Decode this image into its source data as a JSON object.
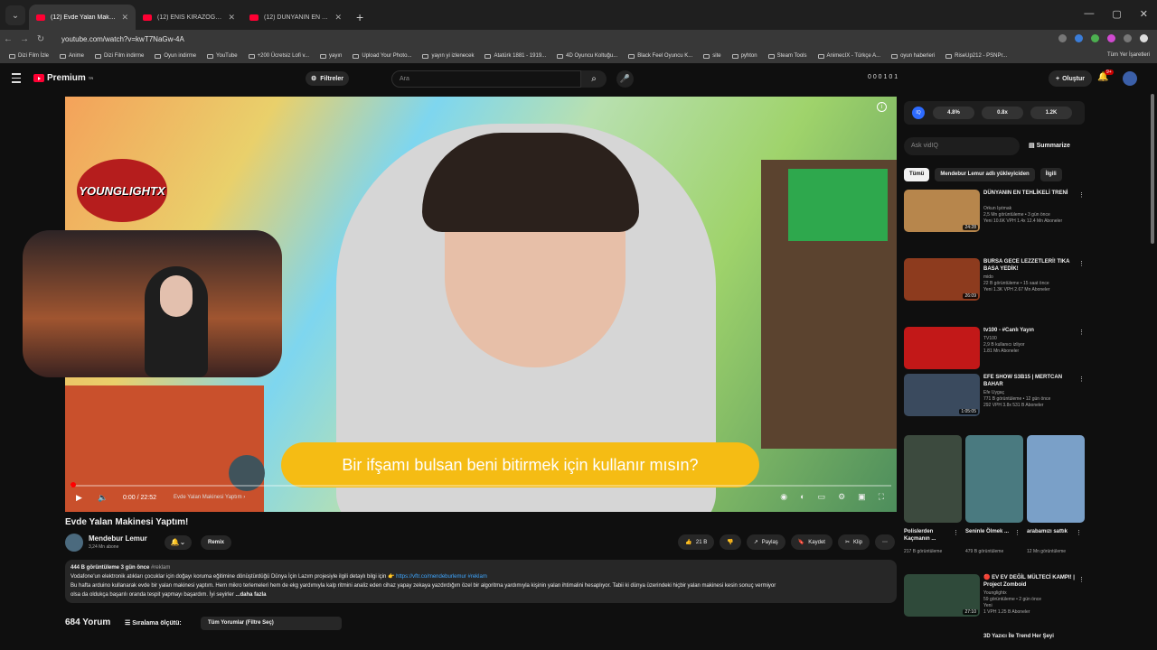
{
  "browser": {
    "tabs": [
      {
        "label": "(12) Evde Yalan Makinesi Yaptım",
        "active": true
      },
      {
        "label": "(12) ENİS KIRAZOĞLU OYUN OYNUYOR",
        "active": false
      },
      {
        "label": "(12) DÜNYANIN EN TEHLİKELİ TRENİ",
        "active": false
      }
    ],
    "new_tab": "+",
    "url": "youtube.com/watch?v=kwT7NaGw-4A",
    "bookmarks": [
      "Dizi Film İzle",
      "Anime",
      "Dizi Film indirme",
      "Oyun indirme",
      "YouTube",
      "+200 Ücretsiz Lofi v...",
      "yayın",
      "Upload Your Photo...",
      "yayın yi izlenecek",
      "Atatürk 1881 - 1919...",
      "4D Oyuncu Koltuğu...",
      "Black Feel Oyuncu K...",
      "site",
      "pyhton",
      "Steam Tools",
      "AnimecIX - Türkçe A...",
      "oyun haberleri",
      "RiseUp212 - PSNPr..."
    ],
    "bookmarks_right": "Tüm Yer İşaretleri"
  },
  "yt": {
    "logo": "Premium",
    "logo_sup": "TR",
    "filters": "Filtreler",
    "search_placeholder": "Ara",
    "stats": "0  0  0  1  0  1",
    "create": "Oluştur",
    "notif": "9+"
  },
  "video": {
    "channel_brand": "YOUNGLIGHTX",
    "subtitle": "Bir ifşamı bulsan beni bitirmek için kullanır mısın?",
    "time": "0:00 / 22:52",
    "chapter": "Evde Yalan Makinesi Yaptım ›",
    "title": "Evde Yalan Makinesi Yaptım!",
    "channel": "Mendebur Lemur",
    "subs": "3,24 Mn abone",
    "remix": "Remix",
    "likes": "21 B",
    "share": "Paylaş",
    "save": "Kaydet",
    "clip": "Klip",
    "desc_meta": "444 B görüntüleme  3 gün önce",
    "desc_tag": "#reklam",
    "desc_line1": "Vodafone'un elektronik atıkları çocuklar için doğayı koruma eğitimine dönüştürdüğü Dünya İçin Lazım projesiyle ilgili detaylı bilgi için 👉",
    "desc_link": "https://vftr.co/mendeburlemur #reklam",
    "desc_line2": "Bu hafta arduino kullanarak evde bir yalan makinesi yaptım. Hem mikro terlemeleri hem de ekg yardımıyla kalp ritmini analiz eden cihaz yapay zekaya yazdırdığım özel bir algoritma yardımıyla kişinin yalan ihtimalini hesaplıyor. Tabii ki dünya üzerindeki hiçbir yalan makinesi kesin sonuç vermiyor",
    "desc_line3": "olsa da oldukça başarılı oranda tespit yapmayı başardım. İyi seyirler",
    "desc_more": "...daha fazla",
    "comments_count": "684 Yorum",
    "sort": "Sıralama ölçütü:",
    "comment_filter": "Tüm Yorumlar (Filtre Seç)"
  },
  "sidebar": {
    "vidiq": {
      "logo": "IQ",
      "s1": "4.8%",
      "s2": "0.8x",
      "s3": "1.2K"
    },
    "ask_placeholder": "Ask vidIQ",
    "summarize": "Summarize",
    "chips": [
      "Tümü",
      "Mendebur Lemur adlı yükleyiciden",
      "İlgili"
    ],
    "recs": [
      {
        "title": "DÜNYANIN EN TEHLİKELİ TRENİ",
        "channel": "Orkun Işıtmak",
        "meta": "2,5 Mn görüntüleme • 3 gün önce",
        "badge": "Yeni",
        "extra": "10.6K VPH  1.4x",
        "extra2": "12.4 Mn Aboneler",
        "duration": "24:28",
        "color": "#b7864c"
      },
      {
        "title": "BURSA GECE LEZZETLERİ! TIKA BASA YEDİK!",
        "channel": "mido",
        "meta": "22 B görüntüleme • 15 saat önce",
        "badge": "Yeni",
        "extra": "1.3K VPH  2.67 Mn Aboneler",
        "extra2": "",
        "duration": "26:09",
        "color": "#8d3b1e"
      },
      {
        "title": "tv100 - #Canlı Yayın",
        "channel": "TV100",
        "meta": "2,9 B kullanıcı izliyor",
        "badge": "",
        "extra": "1.81 Mn Aboneler",
        "extra2": "",
        "duration": "",
        "color": "#c21818"
      },
      {
        "title": "EFE SHOW S3B15 | MERTCAN BAHAR",
        "channel": "Efe Uygaç",
        "meta": "771 B görüntüleme • 12 gün önce",
        "badge": "",
        "extra": "292 VPH  3.8x  531 B Aboneler",
        "extra2": "",
        "duration": "1:05:05",
        "color": "#3a4a5e"
      }
    ],
    "shorts": [
      {
        "title": "Polislerden Kaçmanın ...",
        "views": "217 B görüntüleme",
        "color": "#3c4a3e"
      },
      {
        "title": "Seninle Ölmek ...",
        "views": "479 B görüntüleme",
        "color": "#4a7a80"
      },
      {
        "title": "arabamızı sattık",
        "views": "12 Mn görüntüleme",
        "color": "#7aa0c8"
      }
    ],
    "rec5": {
      "title": "🔴 EV EV DEĞİL MÜLTECİ KAMPI! | Project Zomboid",
      "channel": "Younglightx",
      "meta": "59 görüntüleme • 2 gün önce",
      "badge": "Yeni",
      "extra": "1 VPH  1.25 B Aboneler",
      "duration": "27:10",
      "color": "#2f4a3a"
    },
    "rec6": {
      "title": "3D Yazıcı İle Trend Her Şeyi"
    }
  }
}
